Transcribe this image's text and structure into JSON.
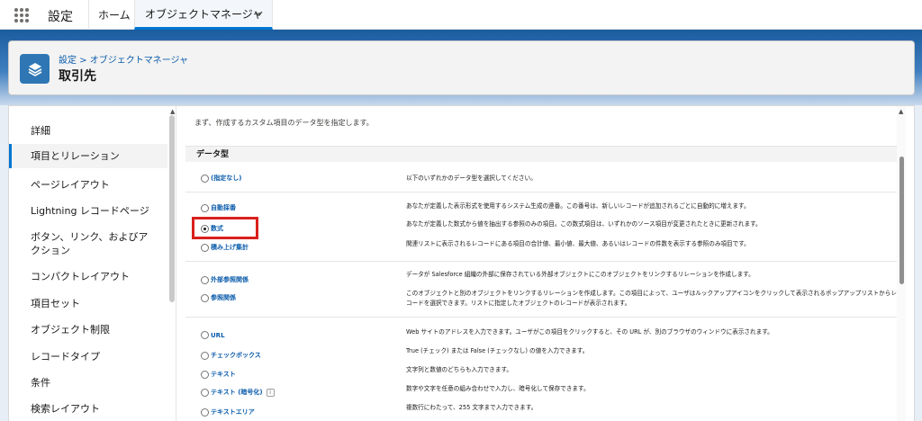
{
  "topnav": {
    "app_name": "設定",
    "tabs": [
      {
        "label": "ホーム"
      },
      {
        "label": "オブジェクトマネージャ"
      }
    ]
  },
  "header": {
    "breadcrumb": "設定 > オブジェクトマネージャ",
    "title": "取引先"
  },
  "sidebar": {
    "items": [
      {
        "label": "詳細"
      },
      {
        "label": "項目とリレーション"
      },
      {
        "label": "ページレイアウト"
      },
      {
        "label": "Lightning レコードページ"
      },
      {
        "label": "ボタン、リンク、およびア"
      },
      {
        "label": "クション"
      },
      {
        "label": "コンパクトレイアウト"
      },
      {
        "label": "項目セット"
      },
      {
        "label": "オブジェクト制限"
      },
      {
        "label": "レコードタイプ"
      },
      {
        "label": "条件"
      },
      {
        "label": "検索レイアウト"
      }
    ]
  },
  "content": {
    "intro": "まず、作成するカスタム項目のデータ型を指定します。",
    "section_title": "データ型",
    "options": [
      {
        "label": "(指定なし)",
        "desc": "以下のいずれかのデータ型を選択してください。",
        "checked": false
      },
      {
        "label": "自動採番",
        "desc": "あなたが定義した表示形式を使用するシステム生成の連番。この番号は、新しいレコードが追加されるごとに自動的に増えます。",
        "checked": false
      },
      {
        "label": "数式",
        "desc": "あなたが定義した数式から値を抽出する参照のみの項目。この数式項目は、いずれかのソース項目が変更されたときに更新されます。",
        "checked": true
      },
      {
        "label": "積み上げ集計",
        "desc": "関連リストに表示されるレコードにある項目の合計値、最小値、最大値、あるいはレコードの件数を表示する参照のみ項目です。",
        "checked": false
      },
      {
        "label": "外部参照関係",
        "desc": "データが Salesforce 組織の外部に保存されている外部オブジェクトにこのオブジェクトをリンクするリレーションを作成します。",
        "checked": false
      },
      {
        "label": "参照関係",
        "desc": "このオブジェクトと別のオブジェクトをリンクするリレーションを作成します。この項目によって、ユーザはルックアップアイコンをクリックして表示されるポップアップリストからレコードを選択できます。リストに指定したオブジェクトのレコードが表示されます。",
        "checked": false
      },
      {
        "label": "URL",
        "desc": "Web サイトのアドレスを入力できます。ユーザがこの項目をクリックすると、その URL が、別のブラウザのウィンドウに表示されます。",
        "checked": false
      },
      {
        "label": "チェックボックス",
        "desc": "True (チェック) または False (チェックなし) の値を入力できます。",
        "checked": false
      },
      {
        "label": "テキスト",
        "desc": "文字列と数値のどちらも入力できます。",
        "checked": false
      },
      {
        "label": "テキスト (暗号化)",
        "desc": "数字や文字を任意の組み合わせで入力し、暗号化して保存できます。",
        "checked": false,
        "info": "i"
      },
      {
        "label": "テキストエリア",
        "desc": "複数行にわたって、255 文字まで入力できます。",
        "checked": false
      }
    ]
  },
  "colors": {
    "accent": "#0176d3",
    "link": "#0b5cab",
    "highlight": "#d9211c"
  }
}
